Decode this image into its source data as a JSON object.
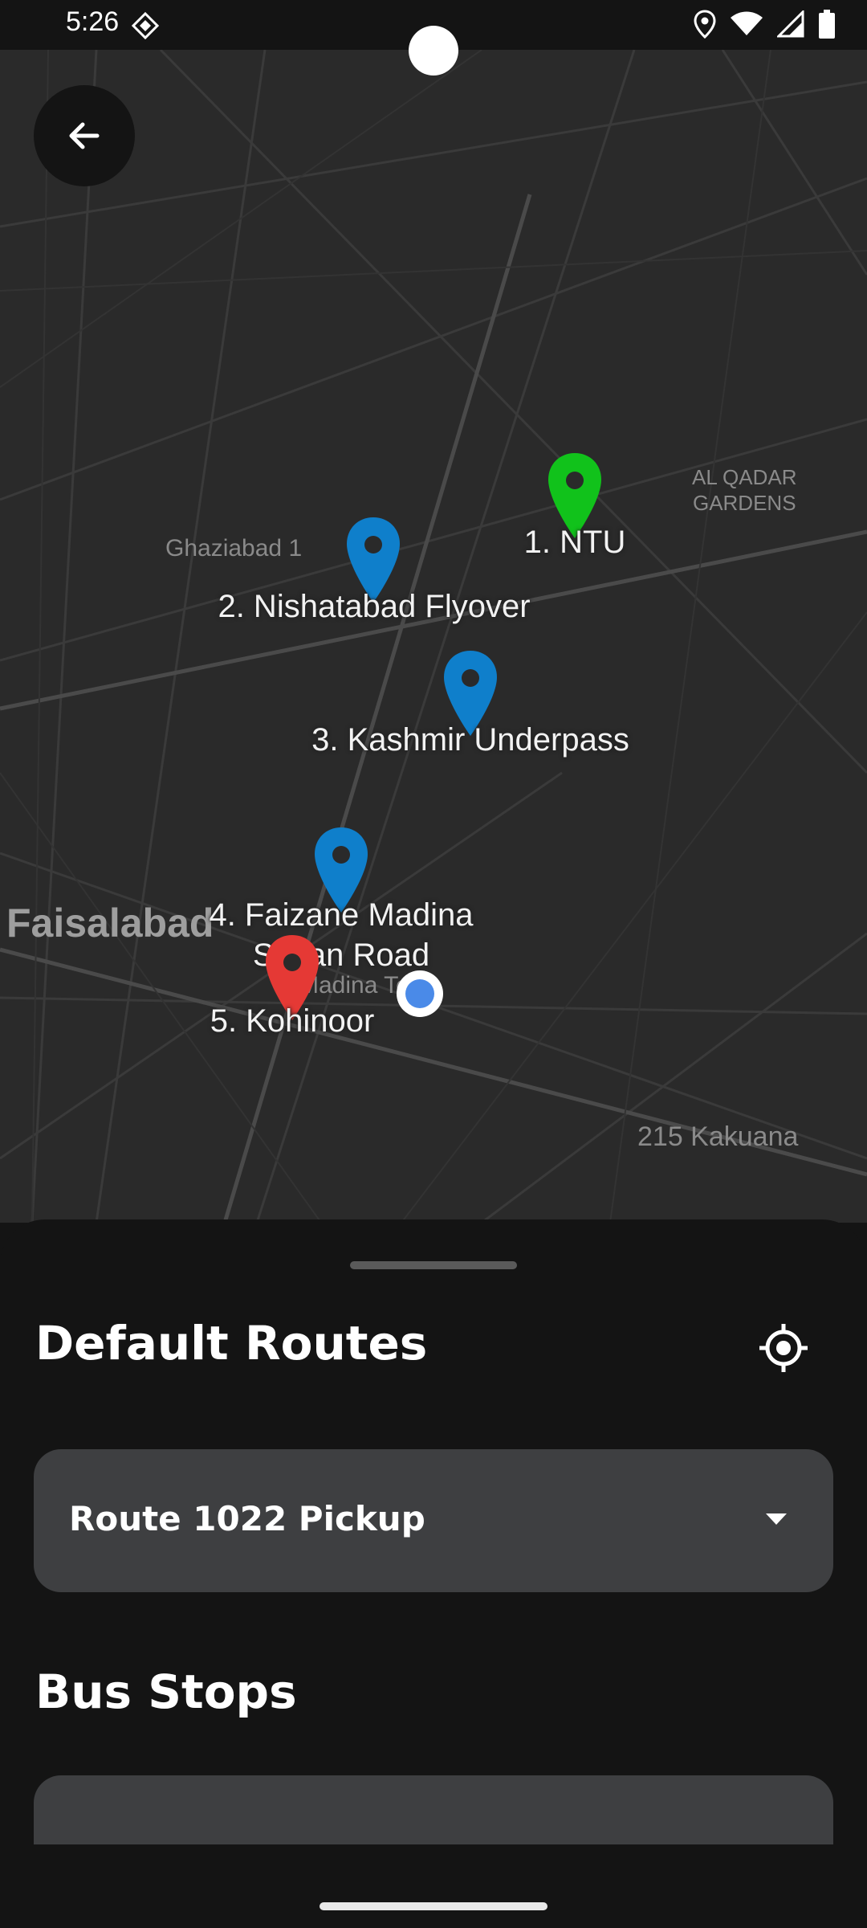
{
  "status_bar": {
    "time": "5:26",
    "icons": [
      "location-icon",
      "wifi-icon",
      "signal-icon",
      "battery-icon"
    ]
  },
  "map": {
    "places": [
      {
        "name": "Ghaziabad 1"
      },
      {
        "name": "AL QADAR\nGARDENS"
      },
      {
        "name": "Faisalabad"
      },
      {
        "name": "Madina Town"
      },
      {
        "name": "215 Kakuana"
      }
    ],
    "markers": [
      {
        "label": "1. NTU",
        "color": "#11c21b"
      },
      {
        "label": "2. Nishatabad Flyover",
        "color": "#0f7fcb"
      },
      {
        "label": "3. Kashmir Underpass",
        "color": "#0f7fcb"
      },
      {
        "label": "4. Faizane Madina\nSusan Road",
        "color": "#0f7fcb"
      },
      {
        "label": "5. Kohinoor",
        "color": "#e53935"
      }
    ]
  },
  "sheet": {
    "title": "Default Routes",
    "selected_route": "Route 1022 Pickup",
    "section_title": "Bus Stops"
  },
  "colors": {
    "background": "#141414",
    "map_background": "#2a2a2a",
    "surface": "#3e3f41",
    "origin_marker": "#11c21b",
    "stop_marker": "#0f7fcb",
    "destination_marker": "#e53935",
    "user_location": "#4a8ae8"
  }
}
